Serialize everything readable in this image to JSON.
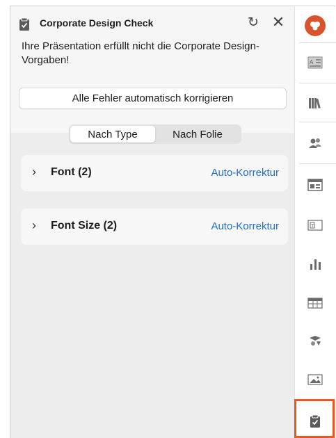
{
  "panel": {
    "title": "Corporate Design Check",
    "message": "Ihre Präsentation erfüllt nicht die Corporate Design-Vorgaben!",
    "fix_all_label": "Alle Fehler automatisch korrigieren",
    "tabs": [
      {
        "label": "Nach Type",
        "active": true
      },
      {
        "label": "Nach Folie",
        "active": false
      }
    ],
    "issues": [
      {
        "label": "Font (2)",
        "action": "Auto-Korrektur"
      },
      {
        "label": "Font Size (2)",
        "action": "Auto-Korrektur"
      }
    ],
    "header_icons": [
      "clipboard-check-icon",
      "refresh-icon",
      "close-icon"
    ]
  },
  "toolbar": {
    "items": [
      "logo-icon",
      "text-layout-icon",
      "library-icon",
      "people-icon",
      "layout-icon",
      "text-frame-icon",
      "chart-icon",
      "table-icon",
      "shapes-icon",
      "image-icon",
      "design-check-icon"
    ],
    "active_item": "design-check-icon"
  },
  "colors": {
    "accent": "#1a6fd1",
    "brand": "#d9532c",
    "active_highlight": "#e8581c"
  }
}
